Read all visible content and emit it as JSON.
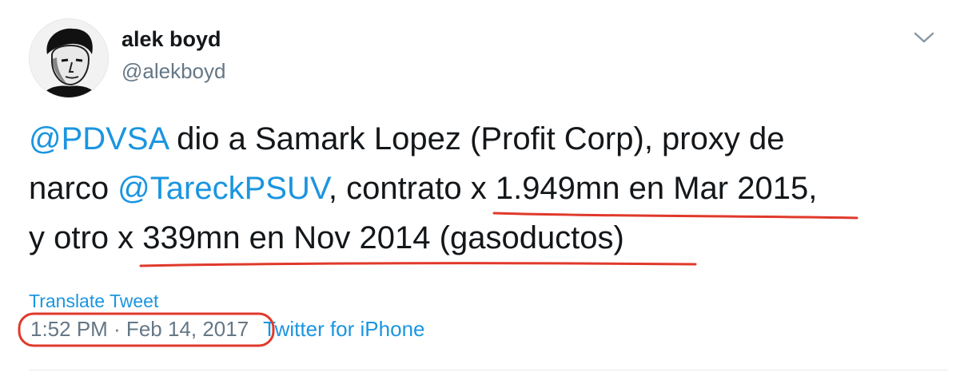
{
  "user": {
    "display_name": "alek boyd",
    "handle": "@alekboyd"
  },
  "tweet": {
    "line1": {
      "mention": "@PDVSA",
      "text": " dio a Samark Lopez (Profit Corp), proxy de"
    },
    "line2": {
      "pre": "narco ",
      "mention": "@TareckPSUV",
      "mid": ", contrato x ",
      "highlight": "1.949mn en Mar 2015",
      "post": ","
    },
    "line3": {
      "pre": "y otro x ",
      "highlight": "339mn en Nov 2014 (gasoductos)"
    }
  },
  "translate_label": "Translate Tweet",
  "meta": {
    "timestamp": "1:52 PM · Feb 14, 2017",
    "source": "Twitter for iPhone"
  },
  "colors": {
    "link": "#1b95e0",
    "annotation": "#e0392b"
  },
  "icons": {
    "caret": "chevron-down-icon",
    "avatar": "user-avatar"
  }
}
